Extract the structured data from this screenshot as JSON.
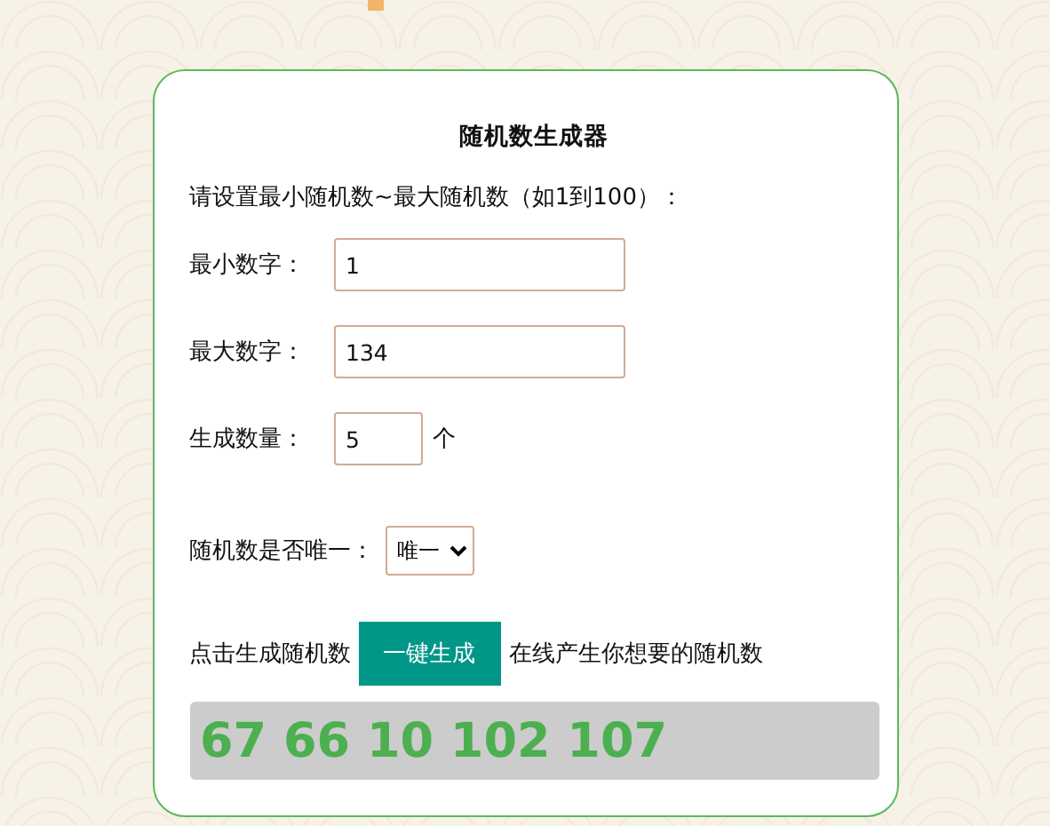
{
  "title": "随机数生成器",
  "intro": "请设置最小随机数~最大随机数（如1到100）：",
  "fields": [
    {
      "label": "最小数字：",
      "value": "1",
      "kind": "wide"
    },
    {
      "label": "最大数字：",
      "value": "134",
      "kind": "wide"
    },
    {
      "label": "生成数量：",
      "value": "5",
      "kind": "short",
      "unit": "个"
    }
  ],
  "unique": {
    "label": "随机数是否唯一：",
    "value": "唯一"
  },
  "generate": {
    "prefix": "点击生成随机数",
    "button": "一键生成",
    "suffix": "在线产生你想要的随机数"
  },
  "result": "67 66 10 102 107"
}
